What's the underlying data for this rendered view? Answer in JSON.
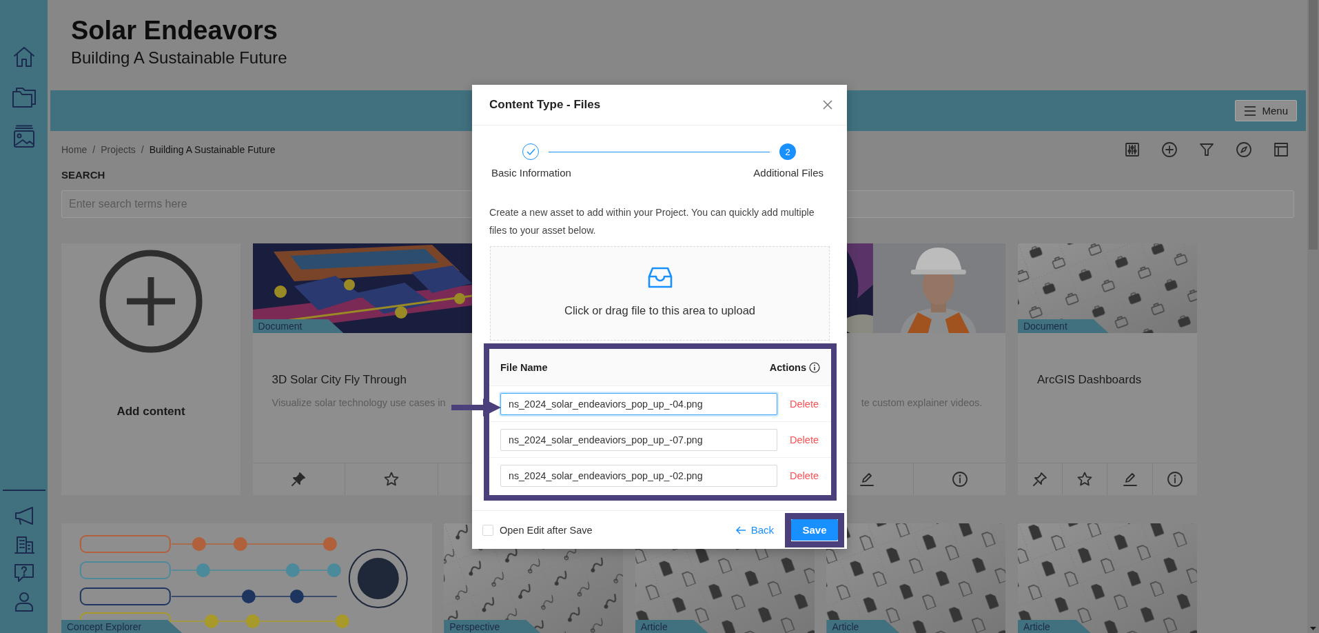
{
  "header": {
    "title": "Solar Endeavors",
    "subtitle": "Building A Sustainable Future"
  },
  "nav_bar": {
    "menu_label": "Menu"
  },
  "breadcrumb": {
    "separator": "/",
    "items": [
      {
        "label": "Home",
        "current": false
      },
      {
        "label": "Projects",
        "current": false
      },
      {
        "label": "Building A Sustainable Future",
        "current": true
      }
    ]
  },
  "search": {
    "label": "SEARCH",
    "placeholder": "Enter search terms here"
  },
  "cards": [
    {
      "kind": "add",
      "label": "Add content"
    },
    {
      "kind": "asset",
      "wide": true,
      "tag": "Document",
      "title": "3D Solar City Fly Through",
      "description": "Visualize solar technology use cases in",
      "actions": [
        {
          "kind": "pin",
          "on": true
        },
        {
          "kind": "star",
          "on": false
        },
        {
          "kind": "covered"
        },
        {
          "kind": "covered"
        }
      ]
    },
    {
      "kind": "asset",
      "wide": true,
      "description": "te custom explainer videos.",
      "actions": [
        {
          "kind": "covered"
        },
        {
          "kind": "covered"
        },
        {
          "kind": "edit"
        },
        {
          "kind": "info"
        }
      ]
    },
    {
      "kind": "asset",
      "wide": false,
      "tag": "Document",
      "title": "ArcGIS Dashboards",
      "actions": [
        {
          "kind": "pin",
          "on": false
        },
        {
          "kind": "star",
          "on": false
        },
        {
          "kind": "edit"
        },
        {
          "kind": "info"
        }
      ]
    },
    {
      "kind": "preview",
      "wide": true,
      "tag": "Concept Explorer"
    },
    {
      "kind": "preview",
      "wide": false,
      "tag": "Perspective"
    },
    {
      "kind": "preview",
      "wide": false,
      "tag": "Article"
    },
    {
      "kind": "preview",
      "wide": false,
      "tag": "Article"
    },
    {
      "kind": "preview",
      "wide": false,
      "tag": "Article"
    }
  ],
  "dialog": {
    "title": "Content Type - Files",
    "steps": [
      {
        "label": "Basic Information",
        "done": true
      },
      {
        "label": "Additional Files",
        "done": false,
        "number": "2"
      }
    ],
    "intro": "Create a new asset to add within your Project. You can quickly add multiple files to your asset below.",
    "upload_text": "Click or drag file to this area to upload",
    "files": {
      "highlighted": true,
      "columns": [
        "File Name",
        "Actions"
      ],
      "rows": [
        {
          "name": "ns_2024_solar_endeaviors_pop_up_-04.png",
          "focused": true,
          "action": "Delete"
        },
        {
          "name": "ns_2024_solar_endeaviors_pop_up_-07.png",
          "focused": false,
          "action": "Delete"
        },
        {
          "name": "ns_2024_solar_endeaviors_pop_up_-02.png",
          "focused": false,
          "action": "Delete"
        }
      ]
    },
    "open_edit_after_save": {
      "label": "Open Edit after Save",
      "checked": false
    },
    "back_label": "Back",
    "save": {
      "label": "Save",
      "highlighted": true
    }
  },
  "pointer_arrow": true
}
